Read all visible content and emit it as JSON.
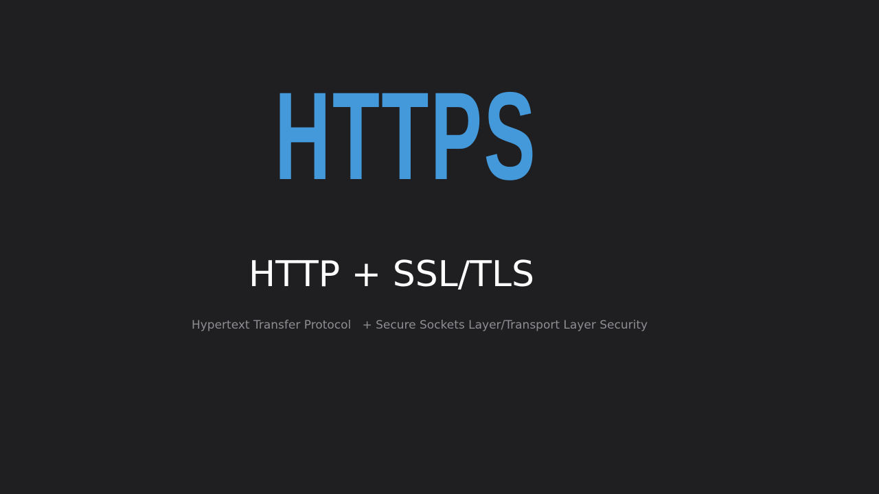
{
  "slide": {
    "title": "HTTPS",
    "subtitle": "HTTP + SSL/TLS",
    "expansion": "Hypertext Transfer Protocol   + Secure Sockets Layer/Transport Layer Security"
  },
  "colors": {
    "background": "#1f1e21",
    "title": "#4399d9",
    "subtitle": "#ffffff",
    "expansion": "#8e8e92"
  }
}
